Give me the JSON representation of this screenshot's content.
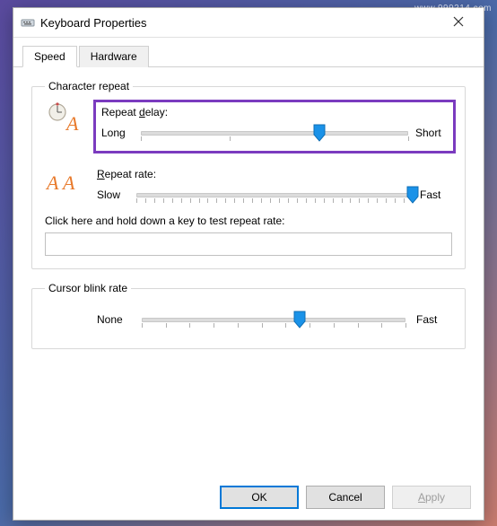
{
  "watermark": "www.999214.com",
  "window": {
    "title": "Keyboard Properties"
  },
  "tabs": {
    "speed": "Speed",
    "hardware": "Hardware",
    "active": "speed"
  },
  "character_repeat": {
    "legend": "Character repeat",
    "repeat_delay": {
      "label_prefix": "Repeat ",
      "label_underlined": "d",
      "label_suffix": "elay:",
      "left": "Long",
      "right": "Short",
      "min": 0,
      "max": 3,
      "value": 2,
      "ticks": 4
    },
    "repeat_rate": {
      "label_underlined": "R",
      "label_suffix": "epeat rate:",
      "left": "Slow",
      "right": "Fast",
      "min": 0,
      "max": 31,
      "value": 31,
      "ticks": 32
    },
    "test_label": "Click here and hold down a key to test repeat rate:",
    "test_value": ""
  },
  "cursor_blink": {
    "legend": "Cursor blink rate",
    "left": "None",
    "right": "Fast",
    "min": 0,
    "max": 10,
    "value": 6,
    "ticks": 12
  },
  "buttons": {
    "ok": "OK",
    "cancel": "Cancel",
    "apply": "Apply"
  },
  "icons": {
    "keyboard": "keyboard-icon",
    "close": "close-icon",
    "clock_a": "clock-a-icon",
    "aa": "aa-icon"
  }
}
